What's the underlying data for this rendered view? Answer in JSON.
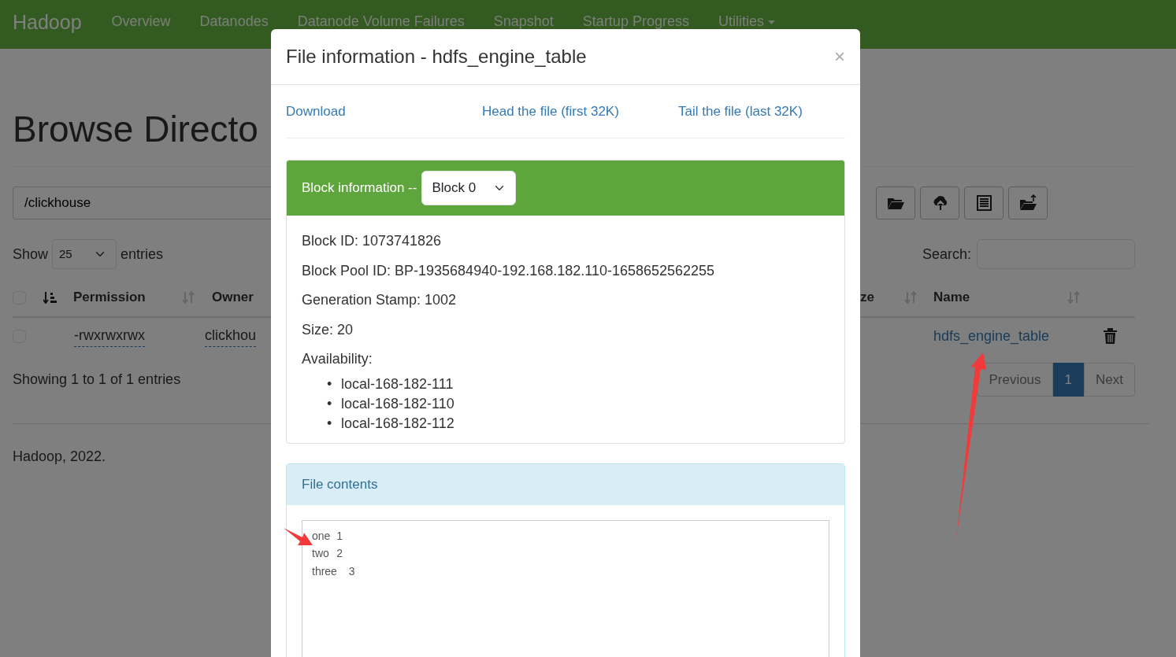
{
  "navbar": {
    "brand": "Hadoop",
    "items": [
      {
        "label": "Overview",
        "selected": false
      },
      {
        "label": "Datanodes",
        "selected": false
      },
      {
        "label": "Datanode Volume Failures",
        "selected": false
      },
      {
        "label": "Snapshot",
        "selected": false
      },
      {
        "label": "Startup Progress",
        "selected": false
      }
    ],
    "dropdown": "Utilities"
  },
  "page": {
    "title": "Browse Directo",
    "path": "/clickhouse",
    "show_label": "Show",
    "page_size": "25",
    "entries_label": "entries",
    "search_label": "Search:",
    "header_checkbox": {
      "checked": false,
      "sorted": true
    },
    "columns": [
      {
        "label": "Permission",
        "sorted": false
      },
      {
        "label": "Owner"
      },
      {
        "label": "ze",
        "sorted": false
      },
      {
        "label": "Name",
        "sorted": false
      }
    ],
    "rows": [
      {
        "checked": false,
        "permission": "-rwxrwxrwx",
        "owner": "clickhou",
        "name": "hdfs_engine_table"
      }
    ],
    "info": "Showing 1 to 1 of 1 entries",
    "pagination": [
      {
        "label": "Previous",
        "selected": false
      },
      {
        "label": "1",
        "selected": true
      },
      {
        "label": "Next",
        "selected": false
      }
    ],
    "footer": "Hadoop, 2022."
  },
  "modal": {
    "title": "File information - hdfs_engine_table",
    "close": "×",
    "links": [
      "Download",
      "Head the file (first 32K)",
      "Tail the file (last 32K)"
    ],
    "block_card": {
      "title": "Block information --",
      "block": "Block 0",
      "lines": [
        "Block ID: 1073741826",
        "Block Pool ID: BP-1935684940-192.168.182.110-1658652562255",
        "Generation Stamp: 1002",
        "Size: 20",
        "Availability:"
      ],
      "hosts": [
        {
          "marker": "•",
          "text": "local-168-182-111"
        },
        {
          "marker": "•",
          "text": "local-168-182-110"
        },
        {
          "marker": "•",
          "text": "local-168-182-112"
        }
      ]
    },
    "contents_card": {
      "title": "File contents",
      "text": "one\t1\ntwo\t2\nthree\t3"
    }
  }
}
